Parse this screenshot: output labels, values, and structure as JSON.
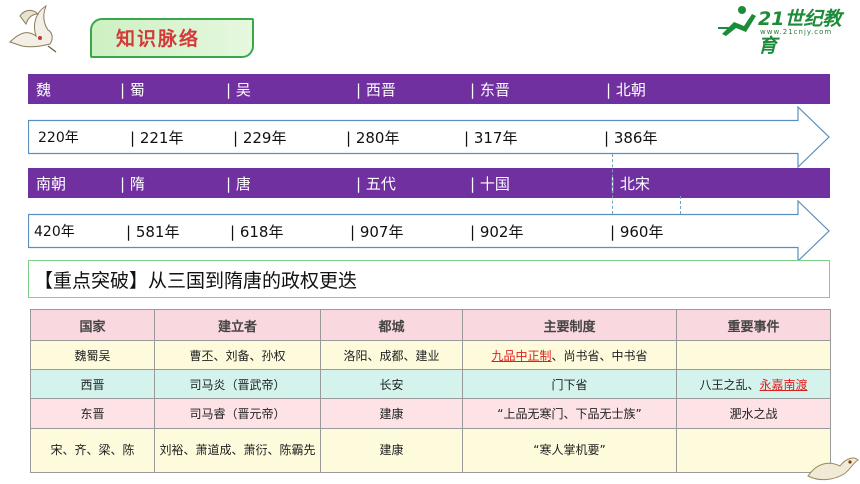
{
  "header": {
    "title": "知识脉络",
    "logo_main": "21世纪教育",
    "logo_sub": "www.21cnjy.com"
  },
  "timeline1": {
    "dynasties": [
      "魏",
      "| 蜀",
      "| 吴",
      "| 西晋",
      "| 东晋",
      "| 北朝"
    ],
    "years": [
      "220年",
      "| 221年",
      "| 229年",
      "| 280年",
      "| 317年",
      "| 386年"
    ]
  },
  "timeline2": {
    "dynasties": [
      "南朝",
      "| 隋",
      "| 唐",
      "| 五代",
      "| 十国",
      "| 北宋"
    ],
    "years": [
      "420年",
      "| 581年",
      "| 618年",
      "| 907年",
      "| 902年",
      "| 960年"
    ]
  },
  "key_title": "【重点突破】从三国到隋唐的政权更迭",
  "table": {
    "headers": [
      "国家",
      "建立者",
      "都城",
      "主要制度",
      "重要事件"
    ],
    "rows": [
      {
        "country": "魏蜀吴",
        "founder": "曹丕、刘备、孙权",
        "capital": "洛阳、成都、建业",
        "system_red": "九品中正制",
        "system_rest": "、尚书省、中书省",
        "event_plain": "",
        "event_red": ""
      },
      {
        "country": "西晋",
        "founder": "司马炎（晋武帝）",
        "capital": "长安",
        "system_red": "",
        "system_rest": "门下省",
        "event_plain": "八王之乱、",
        "event_red": "永嘉南渡"
      },
      {
        "country": "东晋",
        "founder": "司马睿（晋元帝）",
        "capital": "建康",
        "system_red": "",
        "system_rest": "“上品无寒门、下品无士族”",
        "event_plain": "淝水之战",
        "event_red": ""
      },
      {
        "country": "宋、齐、梁、陈",
        "founder": "刘裕、萧道成、萧衍、陈霸先",
        "capital": "建康",
        "system_red": "",
        "system_rest": "“寒人掌机要”",
        "event_plain": "",
        "event_red": ""
      }
    ]
  },
  "colors": {
    "band": "#7030a0",
    "accent_red": "#e01f1f",
    "title_red": "#d43a3a",
    "green": "#3aa84a"
  }
}
